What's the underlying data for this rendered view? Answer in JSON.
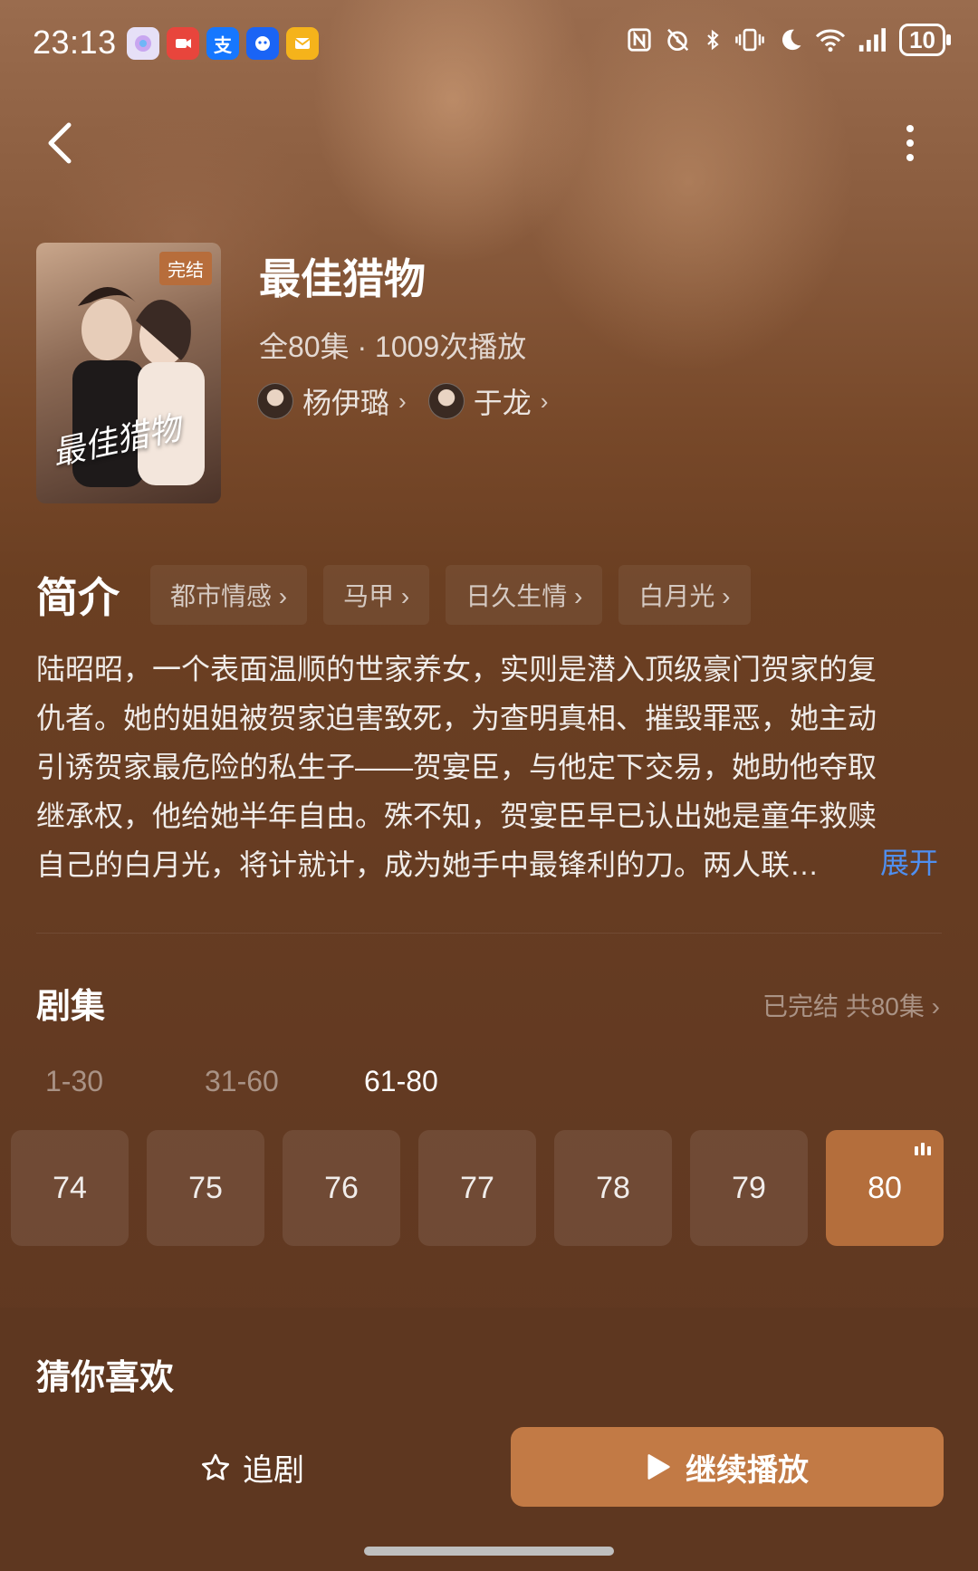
{
  "status_bar": {
    "time": "23:13",
    "battery": "10",
    "apps": [
      {
        "icon": "camera-app-icon",
        "color": "#e6e0f7"
      },
      {
        "icon": "video-app-icon",
        "color": "#e8453c"
      },
      {
        "icon": "alipay-icon",
        "label": "支",
        "color": "#1677ff"
      },
      {
        "icon": "robot-app-icon",
        "color": "#1a64f5"
      },
      {
        "icon": "mail-app-icon",
        "color": "#f5b31b"
      }
    ]
  },
  "show": {
    "title": "最佳猎物",
    "badge": "完结",
    "poster_title": "最佳猎物",
    "meta": "全80集 · 1009次播放",
    "cast": [
      {
        "name": "杨伊璐"
      },
      {
        "name": "于龙"
      }
    ]
  },
  "intro": {
    "heading": "简介",
    "tags": [
      "都市情感",
      "马甲",
      "日久生情",
      "白月光"
    ],
    "description": "陆昭昭，一个表面温顺的世家养女，实则是潜入顶级豪门贺家的复仇者。她的姐姐被贺家迫害致死，为查明真相、摧毁罪恶，她主动引诱贺家最危险的私生子——贺宴臣，与他定下交易，她助他夺取继承权，他给她半年自由。殊不知，贺宴臣早已认出她是童年救赎自己的白月光，将计就计，成为她手中最锋利的刀。两人联…",
    "expand_label": "展开"
  },
  "episodes": {
    "heading": "剧集",
    "status": "已完结 共80集",
    "ranges": [
      "1-30",
      "31-60",
      "61-80"
    ],
    "active_range": "61-80",
    "items": [
      "74",
      "75",
      "76",
      "77",
      "78",
      "79",
      "80"
    ],
    "current": "80"
  },
  "recommend": {
    "heading": "猜你喜欢"
  },
  "bottom_bar": {
    "follow_label": "追剧",
    "play_label": "继续播放",
    "accent_color": "#c27a45"
  }
}
